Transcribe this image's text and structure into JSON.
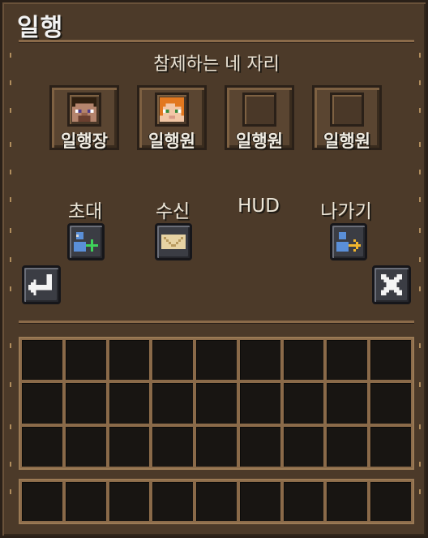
{
  "header": {
    "title": "일행"
  },
  "party": {
    "heading": "참제하는 네 자리",
    "slots": [
      {
        "role": "일행장",
        "avatar": "steve-face-icon"
      },
      {
        "role": "일행원",
        "avatar": "alex-face-icon"
      },
      {
        "role": "일행원",
        "avatar": ""
      },
      {
        "role": "일행원",
        "avatar": ""
      }
    ]
  },
  "actions": {
    "invite_label": "초대",
    "inbox_label": "수신",
    "hud_label": "HUD",
    "leave_label": "나가기"
  },
  "icons": {
    "invite": "add-user-icon",
    "inbox": "envelope-icon",
    "leave": "exit-user-icon",
    "back": "return-arrow-icon",
    "close": "close-icon"
  },
  "colors": {
    "panel": "#4c3a29",
    "plus": "#3fd25a",
    "arrow": "#f2b72e"
  },
  "inventory": {
    "rows": 3,
    "cols": 9,
    "hotbar_cols": 9
  }
}
